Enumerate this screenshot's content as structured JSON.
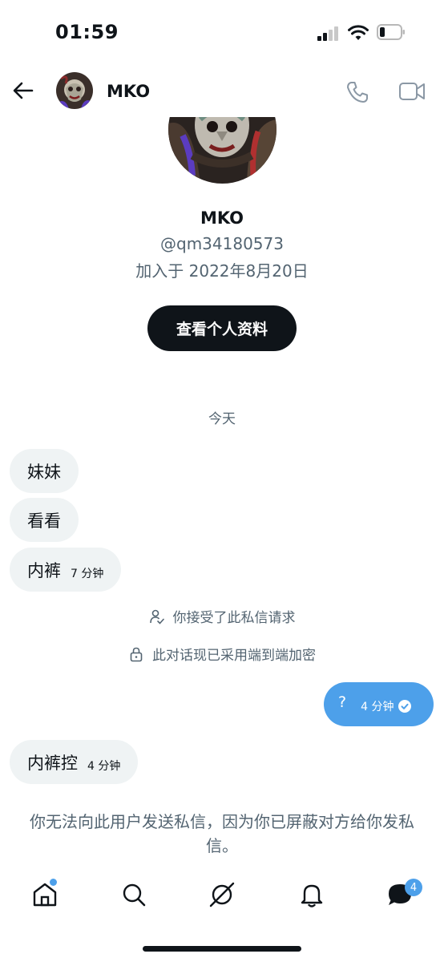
{
  "status_bar": {
    "time": "01:59"
  },
  "header": {
    "name": "MKO"
  },
  "profile": {
    "name": "MKO",
    "handle": "@qm34180573",
    "joined": "加入于 2022年8月20日",
    "view_profile_label": "查看个人资料"
  },
  "conversation": {
    "day_label": "今天",
    "incoming": [
      {
        "text": "妹妹"
      },
      {
        "text": "看看"
      },
      {
        "text": "内裤",
        "time": "7 分钟"
      }
    ],
    "system": {
      "accepted": "你接受了此私信请求",
      "encrypted": "此对话现已采用端到端加密"
    },
    "outgoing": {
      "text": "?",
      "time": "4 分钟"
    },
    "incoming_last": {
      "text": "内裤控",
      "time": "4 分钟"
    },
    "blocked_notice": "你无法向此用户发送私信，因为你已屏蔽对方给你发私信。"
  },
  "tab_bar": {
    "messages_badge": "4",
    "items": [
      "home-icon",
      "search-icon",
      "grok-icon",
      "bell-icon",
      "messages-icon"
    ]
  },
  "colors": {
    "accent": "#4da0ea",
    "text": "#0f1419",
    "secondary": "#536471",
    "bubble": "#eff3f4"
  }
}
